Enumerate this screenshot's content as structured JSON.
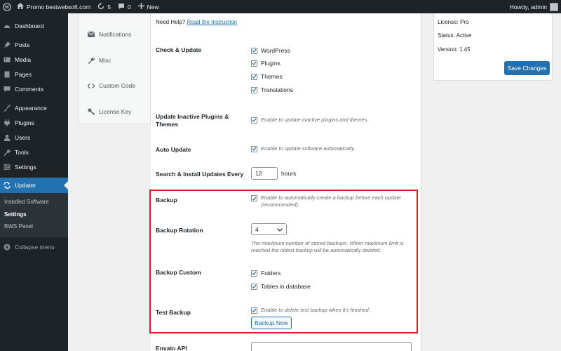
{
  "adminbar": {
    "site_name": "Promo bestwebsoft.com",
    "updates_count": "5",
    "comments_count": "0",
    "new_label": "New",
    "howdy": "Howdy, admin"
  },
  "sidebar": {
    "items": [
      {
        "label": "Dashboard",
        "icon": "dashboard-icon"
      },
      {
        "label": "Posts",
        "icon": "pin-icon"
      },
      {
        "label": "Media",
        "icon": "media-icon"
      },
      {
        "label": "Pages",
        "icon": "page-icon"
      },
      {
        "label": "Comments",
        "icon": "comment-icon"
      },
      {
        "label": "Appearance",
        "icon": "brush-icon"
      },
      {
        "label": "Plugins",
        "icon": "plugin-icon"
      },
      {
        "label": "Users",
        "icon": "user-icon"
      },
      {
        "label": "Tools",
        "icon": "wrench-icon"
      },
      {
        "label": "Settings",
        "icon": "settings-icon"
      },
      {
        "label": "Updater",
        "icon": "updater-icon"
      }
    ],
    "submenu": [
      "Installed Software",
      "Settings",
      "BWS Panel"
    ],
    "collapse": "Collapse menu"
  },
  "tabs": [
    "Notifications",
    "Misc",
    "Custom Code",
    "License Key"
  ],
  "settings": {
    "need_help": "Need Help?",
    "instruction_link": "Read the Instruction",
    "check_update": {
      "label": "Check & Update",
      "options": [
        "WordPress",
        "Plugins",
        "Themes",
        "Translations"
      ]
    },
    "inactive": {
      "label_line1": "Update Inactive Plugins &",
      "label_line2": "Themes",
      "desc": "Enable to update inactive plugins and themes."
    },
    "auto_update": {
      "label": "Auto Update",
      "desc": "Enable to update software automatically."
    },
    "search_install": {
      "label": "Search & Install Updates Every",
      "value": "12",
      "unit": "hours"
    },
    "backup": {
      "label": "Backup",
      "desc_line1": "Enable to automatically create a backup before each update",
      "desc_line2": "(recommended)."
    },
    "rotation": {
      "label": "Backup Rotation",
      "value": "4",
      "desc_line1": "The maximum number of stored backups. When maximum limit is",
      "desc_line2": "reached the oldest backup will be automatically deleted."
    },
    "custom": {
      "label": "Backup Custom",
      "options": [
        "Folders",
        "Tables in database"
      ]
    },
    "test_backup": {
      "label": "Test Backup",
      "desc": "Enable to delete test backup when it's finished.",
      "button": "Backup Now"
    },
    "envato": {
      "label": "Envato API"
    }
  },
  "license": {
    "license_line": "License: Pro",
    "status_line": "Status: Active",
    "version_line": "Version: 1.45",
    "save_button": "Save Changes"
  },
  "colors": {
    "accent": "#2271b1",
    "highlight": "#e01b24",
    "admin_bg": "#1d2327"
  }
}
